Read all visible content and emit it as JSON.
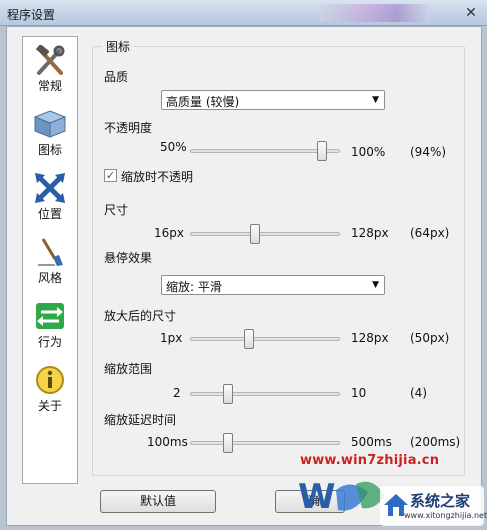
{
  "window": {
    "title": "程序设置",
    "close_symbol": "✕"
  },
  "sidebar": {
    "items": [
      {
        "label": "常规",
        "icon": "tools-icon"
      },
      {
        "label": "图标",
        "icon": "box-icon"
      },
      {
        "label": "位置",
        "icon": "move-arrows-icon"
      },
      {
        "label": "风格",
        "icon": "brush-icon"
      },
      {
        "label": "行为",
        "icon": "green-arrows-icon"
      },
      {
        "label": "关于",
        "icon": "info-icon"
      }
    ]
  },
  "panel": {
    "group_title": "图标",
    "quality": {
      "label": "品质",
      "value": "高质量 (较慢)"
    },
    "opacity": {
      "label": "不透明度",
      "min": "50%",
      "max": "100%",
      "value": "(94%)",
      "fraction": 0.88
    },
    "zoom_opaque": {
      "label": "缩放时不透明",
      "checked": true,
      "check_symbol": "✓"
    },
    "size": {
      "label": "尺寸",
      "min": "16px",
      "max": "128px",
      "value": "(64px)",
      "fraction": 0.43
    },
    "hover_effect": {
      "label": "悬停效果",
      "value": "缩放: 平滑"
    },
    "zoomed_size": {
      "label": "放大后的尺寸",
      "min": "1px",
      "max": "128px",
      "value": "(50px)",
      "fraction": 0.39
    },
    "zoom_range": {
      "label": "缩放范围",
      "min": "2",
      "max": "10",
      "value": "(4)",
      "fraction": 0.25
    },
    "zoom_delay": {
      "label": "缩放延迟时间",
      "min": "100ms",
      "max": "500ms",
      "value": "(200ms)",
      "fraction": 0.25
    }
  },
  "buttons": {
    "default": "默认值",
    "ok_partial": "确"
  },
  "watermark": {
    "url_text": "www.win7zhijia.cn",
    "site_name": "系统之家",
    "site_url": "www.xitongzhijia.net",
    "accent": "#cc2222"
  }
}
